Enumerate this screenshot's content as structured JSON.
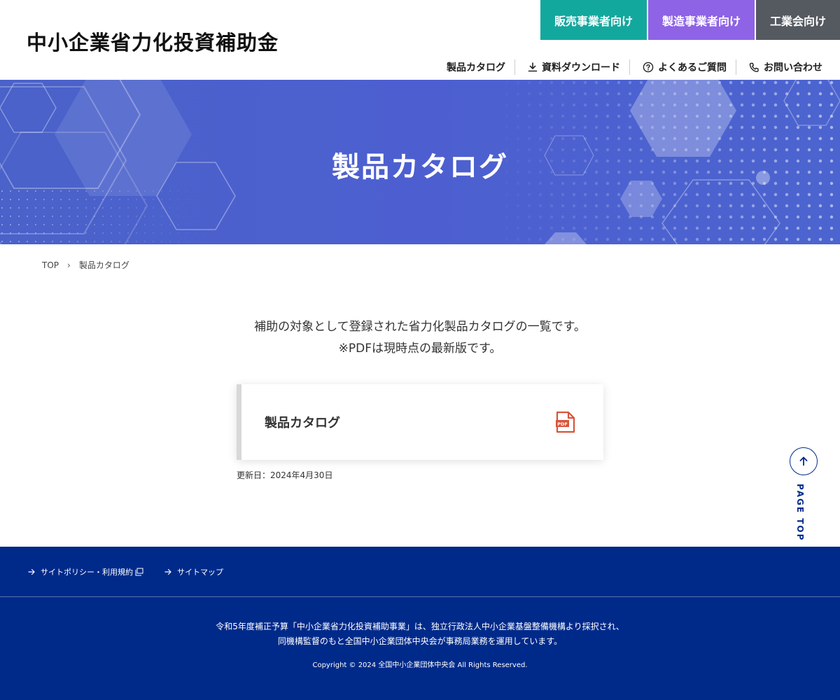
{
  "header": {
    "logo": "中小企業省力化投資補助金",
    "audience": [
      {
        "label": "販売事業者向け",
        "color": "#13a89e"
      },
      {
        "label": "製造事業者向け",
        "color": "#8e63e6"
      },
      {
        "label": "工業会向け",
        "color": "#555a60"
      }
    ],
    "subnav": [
      {
        "label": "製品カタログ",
        "icon": ""
      },
      {
        "label": "資料ダウンロード",
        "icon": "download-icon"
      },
      {
        "label": "よくあるご質問",
        "icon": "question-circle-icon"
      },
      {
        "label": "お問い合わせ",
        "icon": "phone-icon"
      }
    ]
  },
  "hero": {
    "title": "製品カタログ",
    "background_color": "#4d5fd0"
  },
  "breadcrumb": {
    "items": [
      "TOP",
      "製品カタログ"
    ]
  },
  "main": {
    "intro_line1": "補助の対象として登録された省力化製品カタログの一覧です。",
    "intro_line2": "※PDFは現時点の最新版です。",
    "card": {
      "title": "製品カタログ",
      "icon": "pdf-file-icon",
      "icon_text": "PDF"
    },
    "updated": "更新日：2024年4月30日"
  },
  "page_top": {
    "label": "PAGE TOP"
  },
  "footer": {
    "links": [
      {
        "label": "サイトポリシー・利用規約",
        "external": true
      },
      {
        "label": "サイトマップ",
        "external": false
      }
    ],
    "text_line1": "令和5年度補正予算「中小企業省力化投資補助事業」は、独立行政法人中小企業基盤整備機構より採択され、",
    "text_line2": "同機構監督のもと全国中小企業団体中央会が事務局業務を運用しています。",
    "copyright": "Copyright © 2024 全国中小企業団体中央会 All Rights Reserved.",
    "background_color": "#002a8a"
  }
}
